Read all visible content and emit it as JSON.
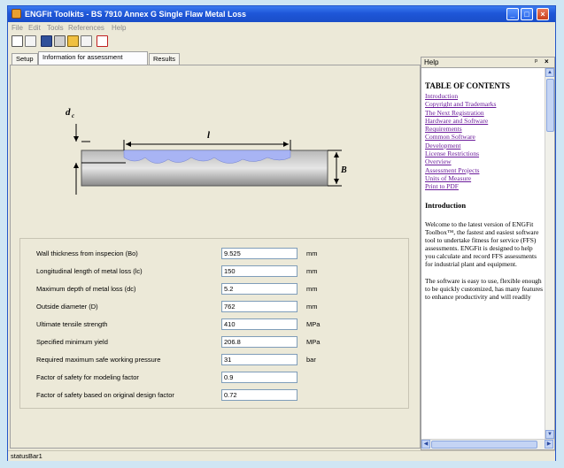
{
  "window": {
    "title": "ENGFit Toolkits - BS 7910 Annex G Single Flaw Metal Loss"
  },
  "menu": [
    "File",
    "Edit",
    "Tools",
    "References",
    "Help"
  ],
  "toolbar": [
    "new",
    "open",
    "save",
    "print",
    "pencil",
    "copy",
    "pdf"
  ],
  "tabs": [
    {
      "label": "Setup",
      "active": false
    },
    {
      "label": "Information for assessment",
      "active": true
    },
    {
      "label": "Results",
      "active": false
    }
  ],
  "diagram": {
    "depth_label": "d",
    "depth_sub": "c",
    "length_label": "l",
    "thickness_label": "B",
    "thickness_sub": "o"
  },
  "form": {
    "rows": [
      {
        "label": "Wall thickness from inspecion (Bo)",
        "value": "9.525",
        "unit": "mm"
      },
      {
        "label": "Longitudinal length of metal loss (lc)",
        "value": "150",
        "unit": "mm"
      },
      {
        "label": "Maximum depth of metal loss (dc)",
        "value": "5.2",
        "unit": "mm"
      },
      {
        "label": "Outside diameter (D)",
        "value": "762",
        "unit": "mm"
      },
      {
        "label": "Ultimate tensile strength",
        "value": "410",
        "unit": "MPa"
      },
      {
        "label": "Specified minimum yield",
        "value": "206.8",
        "unit": "MPa"
      },
      {
        "label": "Required maximum safe working pressure",
        "value": "31",
        "unit": "bar"
      },
      {
        "label": "Factor of safety for modeling factor",
        "value": "0.9",
        "unit": ""
      },
      {
        "label": "Factor of safety based on original design factor",
        "value": "0.72",
        "unit": ""
      }
    ]
  },
  "help": {
    "title": "Help",
    "pin": "ᵖ",
    "close": "×",
    "toc_title": "TABLE OF CONTENTS",
    "links": [
      "Introduction",
      "Copyright and Trademarks",
      "The Next Registration",
      "Hardware and Software",
      "Requirements",
      "Common Software",
      "Development",
      "License Restrictions",
      "Overview",
      "Assessment Projects",
      "Units of Measure",
      "Print to PDF"
    ],
    "section_title": "Introduction",
    "paragraphs": [
      "Welcome to the latest version of ENGFit Toolbox™, the fastest and easiest software tool to undertake fitness for service (FFS) assessments. ENGFit is designed to help you calculate and record FFS assessments for industrial plant and equipment.",
      "The software is easy to use, flexible enough to be quickly customized, has many features to enhance productivity and will readily"
    ]
  },
  "status": {
    "text": "statusBar1"
  },
  "colors": {
    "titlebar": "#1e56d8",
    "metal_loss": "#a8b4f4",
    "link": "#6a1a9a"
  }
}
